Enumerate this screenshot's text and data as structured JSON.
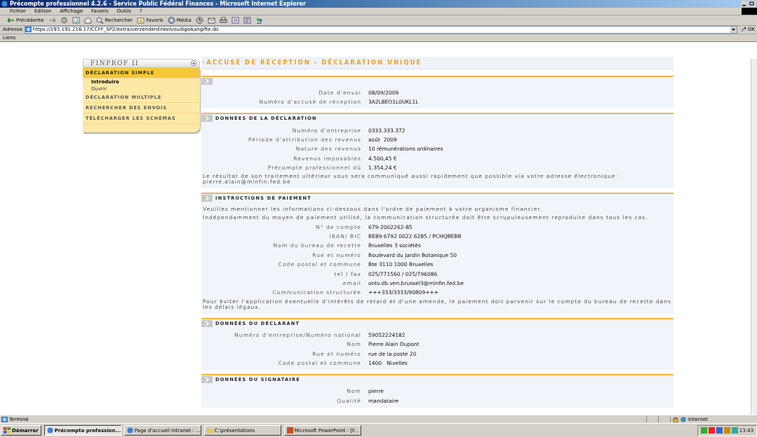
{
  "window": {
    "title": "Précompte professionnel 4.2.6 - Service Public Fédéral Finances - Microsoft Internet Explorer"
  },
  "menu": [
    "Fichier",
    "Edition",
    "Affichage",
    "Favoris",
    "Outils",
    "?"
  ],
  "toolbar": [
    {
      "kind": "back",
      "label": "Précédente"
    },
    {
      "kind": "forward"
    },
    {
      "kind": "stop"
    },
    {
      "kind": "refresh"
    },
    {
      "kind": "home"
    },
    {
      "kind": "search",
      "label": "Rechercher"
    },
    {
      "kind": "favorites",
      "label": "Favoris"
    },
    {
      "kind": "media",
      "label": "Média"
    },
    {
      "kind": "history"
    },
    {
      "kind": "mail"
    },
    {
      "kind": "print"
    },
    {
      "kind": "edit"
    },
    {
      "kind": "discuss"
    },
    {
      "kind": "messenger"
    }
  ],
  "address": {
    "label": "Adresse",
    "value": "https://193.191.216.17/CCFF_SP2/extra/verzendenEnkelvoudigeAangifte.do",
    "go": "OK"
  },
  "links_bar": {
    "label": "Liens"
  },
  "sidebar": {
    "title": "FINPROF II",
    "items": [
      {
        "label": "DÉCLARATION SIMPLE",
        "selected": true,
        "children": [
          {
            "label": "Introduire",
            "selected": true
          },
          {
            "label": "Ouvrir",
            "selected": false
          }
        ]
      },
      {
        "label": "DÉCLARATION MULTIPLE",
        "selected": false
      },
      {
        "label": "RECHERCHER DES ENVOIS",
        "selected": false
      },
      {
        "label": "TÉLÉCHARGER LES SCHÉMAS",
        "selected": false
      }
    ]
  },
  "page_title": "·ACCUSÉ DE RÉCEPTION - DÉCLARATION UNIQUE",
  "sections": [
    {
      "rows": [
        {
          "label": "Date d'envoi",
          "value": "08/09/2009"
        },
        {
          "label": "Numéro d'accusé de réception",
          "value": "3A2L8EO1L0UKL1L"
        }
      ]
    },
    {
      "title": "DONNÉES DE LA DÉCLARATION",
      "rows": [
        {
          "label": "Numéro d'entreprise",
          "value": "0333.333.372"
        },
        {
          "label": "Période d'attribution des revenus",
          "value": "août  2009"
        },
        {
          "label": "Nature des revenus",
          "value": "10 rémunérations ordinaires"
        },
        {
          "label": "Revenus imposables",
          "value": "4.500,45 €"
        },
        {
          "label": "Précompte professionnel dû",
          "value": "1.354,24 €"
        }
      ],
      "note": "Le résultat de son traitement ultérieur vous sera communiqué aussi rapidement que possible via votre adresse électronique : pierre.alain@minfin.fed.be"
    },
    {
      "title": "INSTRUCTIONS DE PAIEMENT",
      "intro": [
        "Veuillez mentionner les informations ci-dessous dans l'ordre de paiement à votre organisme financier.",
        "Indépendamment du moyen de paiement utilisé, la communication structurée doit être scrupuleusement reproduite dans tous les cas."
      ],
      "rows": [
        {
          "label": "N° de compte",
          "value": "679-2002262-85"
        },
        {
          "label": "IBAN/ BIC",
          "value": "BE89 6792 0022 6285 / PCHQBEBB"
        },
        {
          "label": "Nom du bureau de recette",
          "value": "Bruxelles 3 sociétés"
        },
        {
          "label": "Rue et numéro",
          "value": "Boulevard du Jardin Botanique 50"
        },
        {
          "label": "Code postal et commune",
          "value": "Bte 3110 1000 Bruxelles"
        },
        {
          "label": "tel / fax",
          "value": "025/771560 / 025/796086"
        },
        {
          "label": "email",
          "value": "ontv.db.ven.brussel3@minfin.fed.be"
        },
        {
          "label": "Communication structurée",
          "value": "+++333/3333/90809+++"
        }
      ],
      "note": "Pour éviter l'application éventuelle d'intérêts de retard et d'une amende, le paiement doit parvenir sur le compte du bureau de recette dans les délais légaux."
    },
    {
      "title": "DONNÉES DU DÉCLARANT",
      "rows": [
        {
          "label": "Numéro d'entreprise/Numéro national",
          "value": "59052224182"
        },
        {
          "label": "Nom",
          "value": "Pierre Alain Dupont"
        },
        {
          "label": "Rue et numéro",
          "value": "rue de la poste 20"
        },
        {
          "label": "Code postal et commune",
          "value": "1400   Nivelles"
        }
      ]
    },
    {
      "title": "DONNÉES DU SIGNATAIRE",
      "rows": [
        {
          "label": "Nom",
          "value": "pierre"
        },
        {
          "label": "Qualité",
          "value": "mandataire"
        }
      ]
    }
  ],
  "status_bar": {
    "text": "Terminé",
    "zone": "Internet"
  },
  "taskbar": {
    "start": "Démarrer",
    "tasks": [
      {
        "label": "Précompte profession...",
        "selected": true
      },
      {
        "label": "Page d'accueil Intranet - ...",
        "selected": false
      },
      {
        "label": "C:\\présentations",
        "selected": false
      },
      {
        "label": "Microsoft PowerPoint - [F...",
        "selected": false
      }
    ],
    "clock": "13:43"
  }
}
